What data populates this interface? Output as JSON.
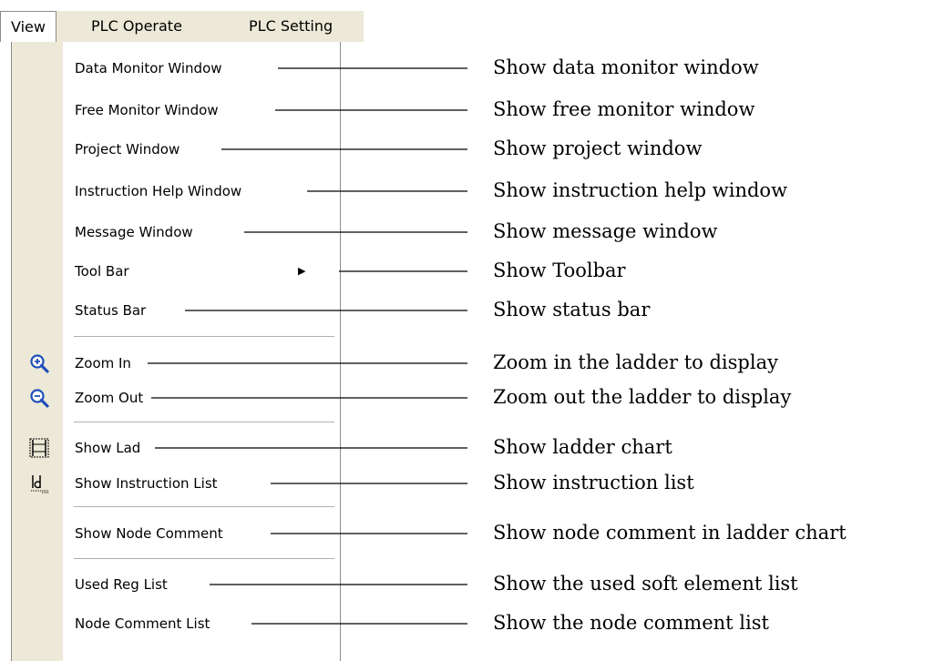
{
  "menubar": {
    "menus": [
      {
        "label": "View",
        "mnemonic": "V"
      },
      {
        "label": "PLC Operate",
        "mnemonic": "P"
      },
      {
        "label": "PLC Setting",
        "mnemonic": "S"
      }
    ]
  },
  "view_menu": {
    "items": [
      {
        "label": "Data Monitor Window"
      },
      {
        "label": "Free Monitor Window"
      },
      {
        "label": "Project Window"
      },
      {
        "label": "Instruction Help Window"
      },
      {
        "label": "Message Window"
      },
      {
        "label": "Tool Bar",
        "has_submenu": true
      },
      {
        "label": "Status Bar"
      },
      {
        "label": "Zoom In",
        "icon": "zoom-in-icon"
      },
      {
        "label": "Zoom Out",
        "icon": "zoom-out-icon"
      },
      {
        "label": "Show Lad",
        "icon": "ladder-chart-icon"
      },
      {
        "label": "Show Instruction List",
        "icon": "instruction-list-icon"
      },
      {
        "label": "Show Node Comment"
      },
      {
        "label": "Used Reg List"
      },
      {
        "label": "Node Comment List"
      }
    ]
  },
  "descriptions": [
    "Show data monitor window",
    "Show free monitor window",
    "Show project window",
    "Show instruction help window",
    "Show message window",
    "Show Toolbar",
    "Show status bar",
    "Zoom in the ladder to display",
    "Zoom out the ladder to display",
    "Show ladder chart",
    "Show instruction list",
    "Show node comment in ladder chart",
    "Show the used soft element list",
    "Show the node comment list"
  ],
  "colors": {
    "menu_background": "#ece9d8",
    "menu_border": "#8c8c8c",
    "separator": "#b0b0b0",
    "icon_blue": "#1f4fb8",
    "text": "#000000"
  }
}
